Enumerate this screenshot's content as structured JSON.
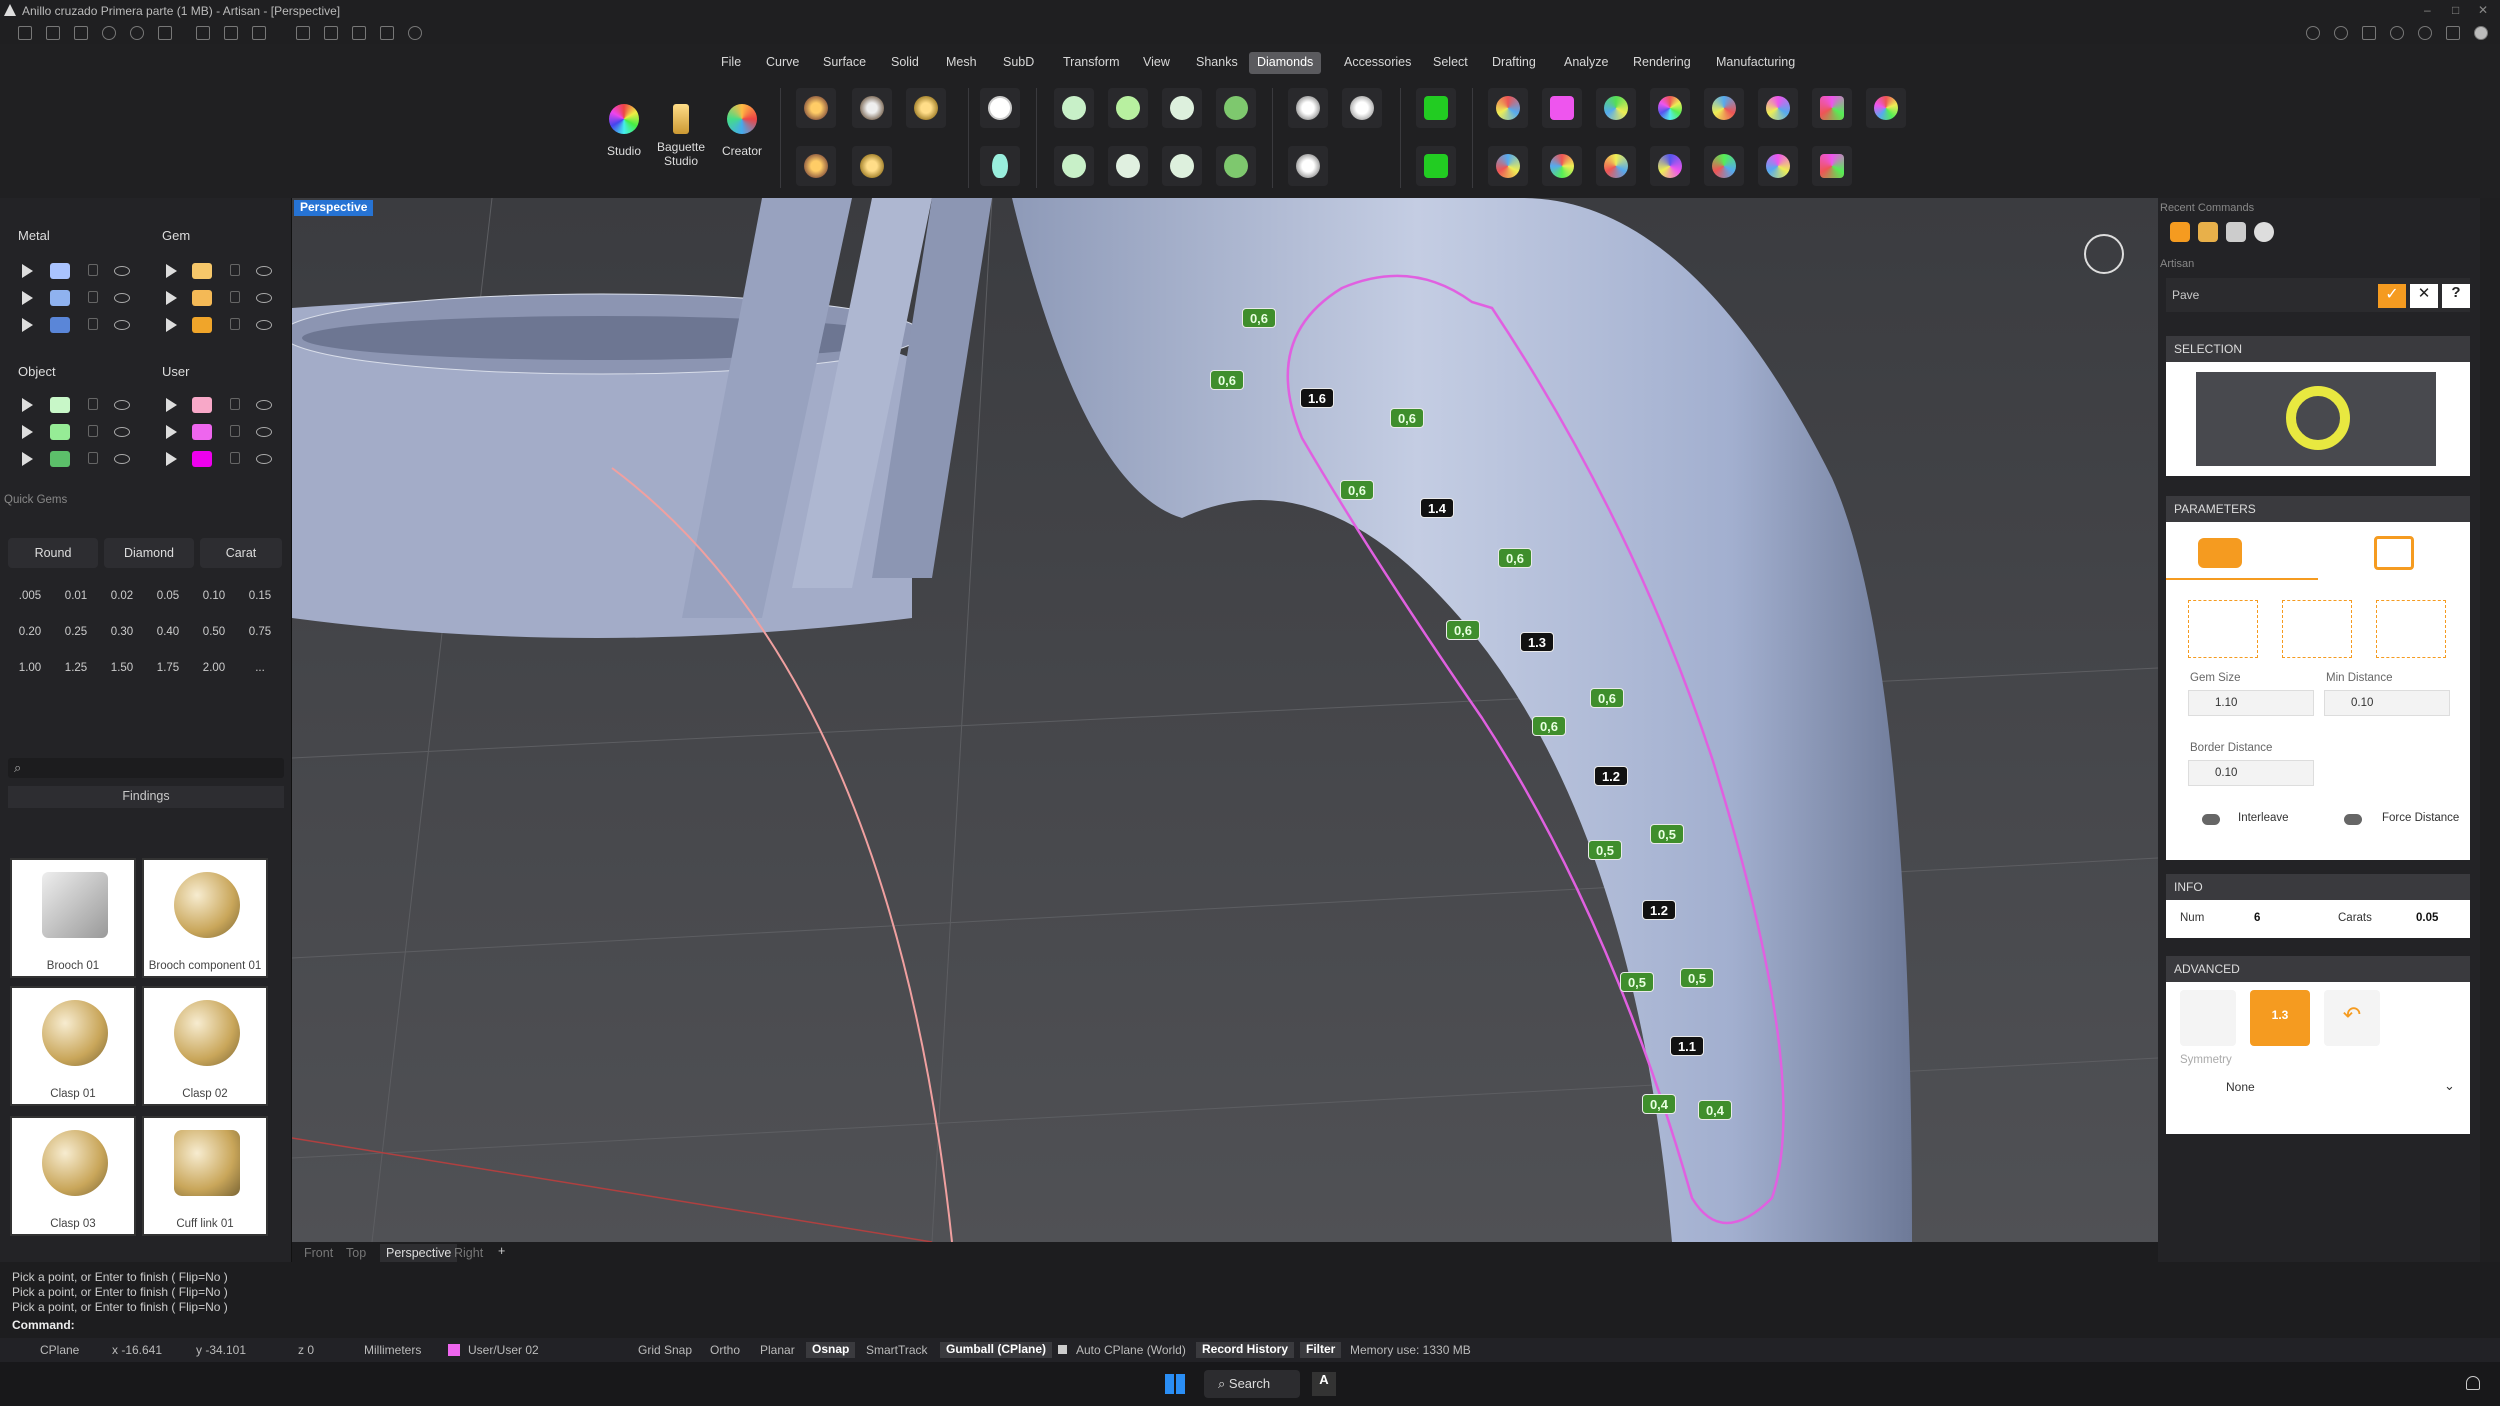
{
  "window": {
    "title": "Anillo cruzado Primera parte (1 MB) - Artisan - [Perspective]"
  },
  "menu": [
    "File",
    "Curve",
    "Surface",
    "Solid",
    "Mesh",
    "SubD",
    "Transform",
    "View",
    "Shanks",
    "Diamonds",
    "Accessories",
    "Select",
    "Drafting",
    "Analyze",
    "Rendering",
    "Manufacturing"
  ],
  "menu_active": "Diamonds",
  "ribbon": {
    "studio": "Studio",
    "baguette": "Baguette Studio",
    "creator": "Creator"
  },
  "layers": {
    "metal": "Metal",
    "gem": "Gem",
    "object": "Object",
    "user": "User"
  },
  "quick_gems": {
    "title": "Quick Gems",
    "round": "Round",
    "diamond": "Diamond",
    "carat": "Carat",
    "sizes": [
      ".005",
      "0.01",
      "0.02",
      "0.05",
      "0.10",
      "0.15",
      "0.20",
      "0.25",
      "0.30",
      "0.40",
      "0.50",
      "0.75",
      "1.00",
      "1.25",
      "1.50",
      "1.75",
      "2.00",
      "..."
    ]
  },
  "library": {
    "category": "Findings",
    "items": [
      "Brooch 01",
      "Brooch component 01",
      "Clasp 01",
      "Clasp 02",
      "Clasp 03",
      "Cuff link 01"
    ]
  },
  "viewport": {
    "name": "Perspective",
    "tabs": [
      "Front",
      "Top",
      "Perspective",
      "Right"
    ],
    "active_tab": "Perspective"
  },
  "dimensions": {
    "green": [
      "0,6",
      "0,6",
      "0,6",
      "0,6",
      "0,6",
      "0,6",
      "0,6",
      "0,6",
      "0,5",
      "0,5",
      "0,5",
      "0,5",
      "0,4",
      "0,4"
    ],
    "black": [
      "1.6",
      "1.4",
      "1.3",
      "1.2",
      "1.2",
      "1.1"
    ]
  },
  "right_panel": {
    "recent": "Recent Commands",
    "artisan": "Artisan",
    "command": "Pave",
    "selection": "SELECTION",
    "parameters": "PARAMETERS",
    "gem_size_label": "Gem Size",
    "gem_size": "1.10",
    "min_distance_label": "Min Distance",
    "min_distance": "0.10",
    "border_distance_label": "Border Distance",
    "border_distance": "0.10",
    "interleave": "Interleave",
    "force_distance": "Force Distance",
    "info": "INFO",
    "num_label": "Num",
    "num": "6",
    "carats_label": "Carats",
    "carats": "0.05",
    "advanced": "ADVANCED",
    "adv_value": "1.3",
    "symmetry_label": "Symmetry",
    "symmetry": "None"
  },
  "command": {
    "history": [
      "Pick a point, or Enter to finish ( Flip=No )",
      "Pick a point, or Enter to finish ( Flip=No )",
      "Pick a point, or Enter to finish ( Flip=No )"
    ],
    "prompt": "Command:"
  },
  "status": {
    "cplane": "CPlane",
    "x": "x -16.641",
    "y": "y -34.101",
    "z": "z 0",
    "units": "Millimeters",
    "layer": "User/User 02",
    "grid_snap": "Grid Snap",
    "ortho": "Ortho",
    "planar": "Planar",
    "osnap": "Osnap",
    "smarttrack": "SmartTrack",
    "gumball": "Gumball (CPlane)",
    "auto_cplane": "Auto CPlane (World)",
    "record_history": "Record History",
    "filter": "Filter",
    "memory": "Memory use: 1330 MB"
  },
  "taskbar": {
    "search": "Search"
  }
}
